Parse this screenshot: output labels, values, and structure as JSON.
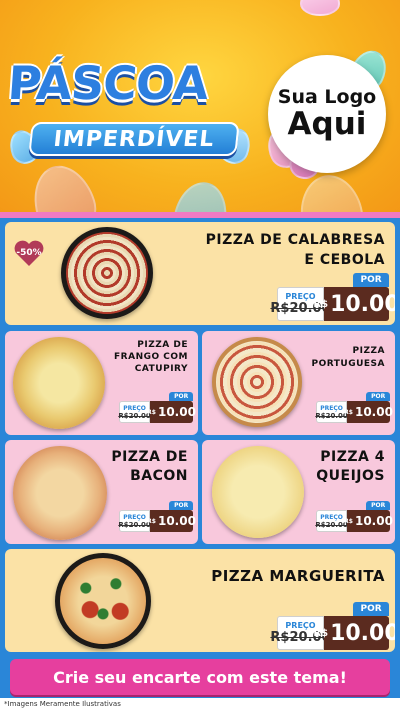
{
  "header": {
    "title": "PÁSCOA",
    "subtitle": "IMPERDÍVEL",
    "logo_line1": "Sua Logo",
    "logo_line2": "Aqui"
  },
  "badge": {
    "text": "-50%"
  },
  "labels": {
    "de": "PREÇO",
    "por": "POR",
    "currency": "R$"
  },
  "items": [
    {
      "name": "PIZZA DE CALABRESA E CEBOLA",
      "old_price": "R$20.00",
      "new_price": "10.00"
    },
    {
      "name": "PIZZA DE FRANGO COM CATUPIRY",
      "old_price": "R$20.00",
      "new_price": "10.00"
    },
    {
      "name": "PIZZA PORTUGUESA",
      "old_price": "R$20.00",
      "new_price": "10.00"
    },
    {
      "name": "PIZZA DE BACON",
      "old_price": "R$20.00",
      "new_price": "10.00"
    },
    {
      "name": "PIZZA 4 QUEIJOS",
      "old_price": "R$20.00",
      "new_price": "10.00"
    },
    {
      "name": "PIZZA MARGUERITA",
      "old_price": "R$20.00",
      "new_price": "10.00"
    }
  ],
  "cta": {
    "label": "Crie seu encarte com este tema!"
  },
  "footer": {
    "note": "*Imagens Meramente Ilustrativas"
  },
  "colors": {
    "header_bg": "#f8b21e",
    "panel_bg": "#2a86d8",
    "card_cream": "#fbe2a6",
    "card_pink": "#f8c8dc",
    "price_bg": "#5b2b1f",
    "cta_bg": "#e63f9e"
  }
}
